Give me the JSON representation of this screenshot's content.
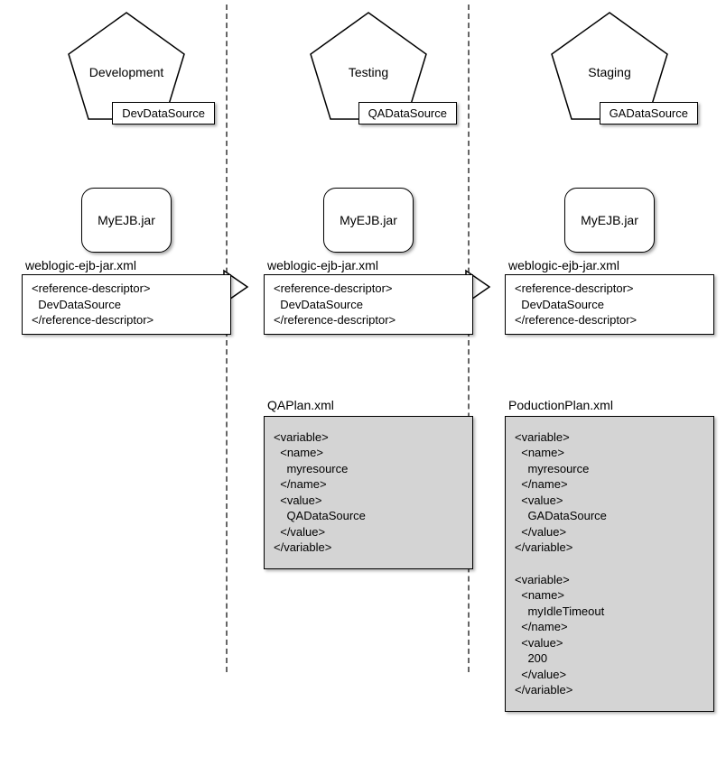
{
  "columns": [
    {
      "env": "Development",
      "datasource": "DevDataSource",
      "jar": "MyEJB.jar",
      "descriptor_file": "weblogic-ejb-jar.xml",
      "reference_descriptor": "<reference-descriptor>\n  DevDataSource\n</reference-descriptor>",
      "plan_file": "",
      "plan_content": ""
    },
    {
      "env": "Testing",
      "datasource": "QADataSource",
      "jar": "MyEJB.jar",
      "descriptor_file": "weblogic-ejb-jar.xml",
      "reference_descriptor": "<reference-descriptor>\n  DevDataSource\n</reference-descriptor>",
      "plan_file": "QAPlan.xml",
      "plan_content": "<variable>\n  <name>\n    myresource\n  </name>\n  <value>\n    QADataSource\n  </value>\n</variable>"
    },
    {
      "env": "Staging",
      "datasource": "GADataSource",
      "jar": "MyEJB.jar",
      "descriptor_file": "weblogic-ejb-jar.xml",
      "reference_descriptor": "<reference-descriptor>\n  DevDataSource\n</reference-descriptor>",
      "plan_file": "PoductionPlan.xml",
      "plan_content": "<variable>\n  <name>\n    myresource\n  </name>\n  <value>\n    GADataSource\n  </value>\n</variable>\n\n<variable>\n  <name>\n    myIdleTimeout\n  </name>\n  <value>\n    200\n  </value>\n</variable>"
    }
  ]
}
